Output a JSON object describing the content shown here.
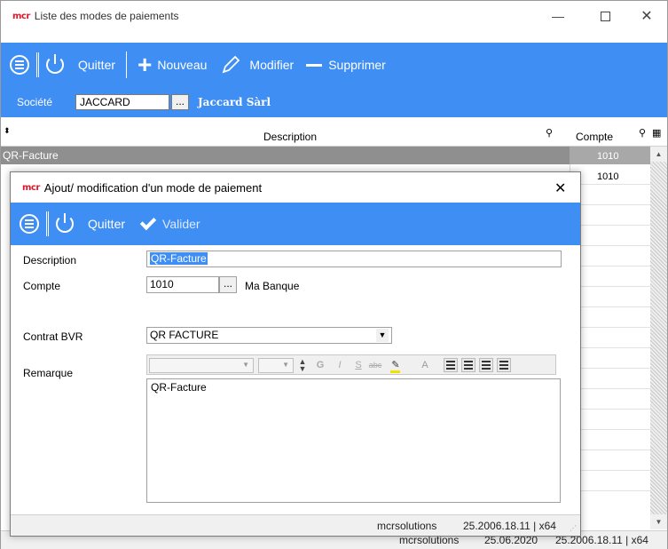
{
  "main": {
    "logo": "mcr",
    "title": "Liste des modes de paiements",
    "toolbar": {
      "quit": "Quitter",
      "new": "Nouveau",
      "edit": "Modifier",
      "delete": "Supprimer"
    },
    "company": {
      "label": "Société",
      "code": "JACCARD",
      "browse": "...",
      "name": "Jaccard Sàrl"
    },
    "grid": {
      "col_description": "Description",
      "col_account": "Compte",
      "rows": [
        {
          "description": "QR-Facture",
          "account": "1010"
        },
        {
          "description": "",
          "account": "1010"
        }
      ]
    },
    "status": {
      "user": "mcrsolutions",
      "date": "25.06.2020",
      "version": "25.2006.18.11 | x64"
    }
  },
  "dialog": {
    "logo": "mcr",
    "title": "Ajout/ modification d'un mode de paiement",
    "toolbar": {
      "quit": "Quitter",
      "validate": "Valider"
    },
    "fields": {
      "description_label": "Description",
      "description_value": "QR-Facture",
      "account_label": "Compte",
      "account_value": "1010",
      "account_browse": "...",
      "account_name": "Ma Banque",
      "contract_label": "Contrat BVR",
      "contract_value": "QR FACTURE",
      "remark_label": "Remarque",
      "remark_value": "QR-Facture"
    },
    "rte": {
      "bold": "G",
      "italic": "I",
      "underline": "S",
      "strike": "abc",
      "font_color": "A"
    },
    "status": {
      "user": "mcrsolutions",
      "version": "25.2006.18.11 | x64"
    }
  },
  "colors": {
    "accent": "#3f8ef4",
    "selected_row": "#8f8f8f",
    "logo_red": "#e0162b"
  }
}
